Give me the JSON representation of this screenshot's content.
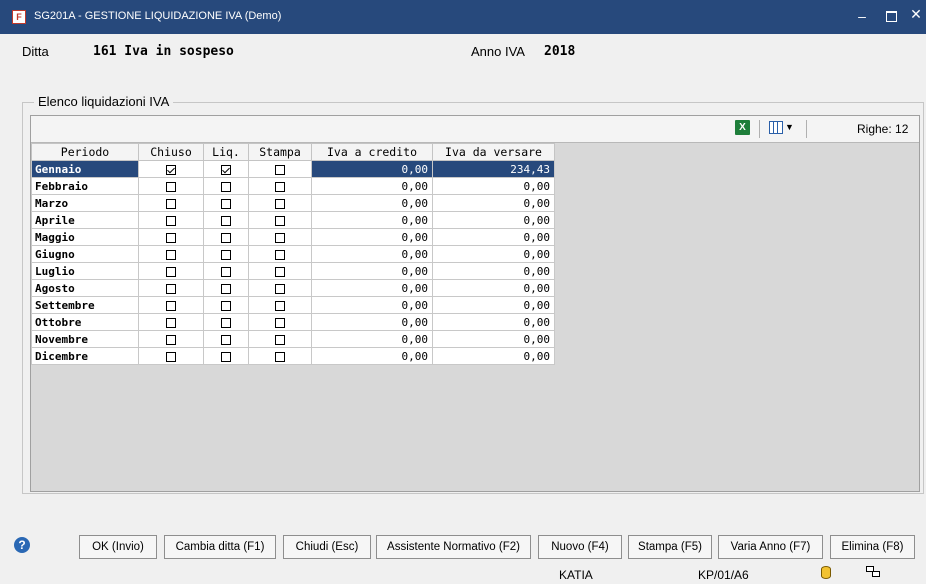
{
  "window": {
    "title": "SG201A - GESTIONE LIQUIDAZIONE IVA  (Demo)",
    "app_icon_letter": "F",
    "minimize_glyph": "–",
    "close_glyph": "✕"
  },
  "header": {
    "ditta_label": "Ditta",
    "ditta_value": "161 Iva in sospeso",
    "anno_label": "Anno IVA",
    "anno_value": "2018"
  },
  "group": {
    "title": "Elenco liquidazioni IVA"
  },
  "toolbar": {
    "excel_icon": "excel-icon",
    "excel_letter": "X",
    "columns_icon": "columns-chooser-icon",
    "dropdown_glyph": "▼",
    "rows_count": "Righe: 12"
  },
  "table": {
    "columns": [
      "Periodo",
      "Chiuso",
      "Liq.",
      "Stampa",
      "Iva a credito",
      "Iva da versare"
    ],
    "rows": [
      {
        "periodo": "Gennaio",
        "chiuso": true,
        "liq": true,
        "stampa": false,
        "credito": "0,00",
        "versare": "234,43",
        "selected": true
      },
      {
        "periodo": "Febbraio",
        "chiuso": false,
        "liq": false,
        "stampa": false,
        "credito": "0,00",
        "versare": "0,00"
      },
      {
        "periodo": "Marzo",
        "chiuso": false,
        "liq": false,
        "stampa": false,
        "credito": "0,00",
        "versare": "0,00"
      },
      {
        "periodo": "Aprile",
        "chiuso": false,
        "liq": false,
        "stampa": false,
        "credito": "0,00",
        "versare": "0,00"
      },
      {
        "periodo": "Maggio",
        "chiuso": false,
        "liq": false,
        "stampa": false,
        "credito": "0,00",
        "versare": "0,00"
      },
      {
        "periodo": "Giugno",
        "chiuso": false,
        "liq": false,
        "stampa": false,
        "credito": "0,00",
        "versare": "0,00"
      },
      {
        "periodo": "Luglio",
        "chiuso": false,
        "liq": false,
        "stampa": false,
        "credito": "0,00",
        "versare": "0,00"
      },
      {
        "periodo": "Agosto",
        "chiuso": false,
        "liq": false,
        "stampa": false,
        "credito": "0,00",
        "versare": "0,00"
      },
      {
        "periodo": "Settembre",
        "chiuso": false,
        "liq": false,
        "stampa": false,
        "credito": "0,00",
        "versare": "0,00"
      },
      {
        "periodo": "Ottobre",
        "chiuso": false,
        "liq": false,
        "stampa": false,
        "credito": "0,00",
        "versare": "0,00"
      },
      {
        "periodo": "Novembre",
        "chiuso": false,
        "liq": false,
        "stampa": false,
        "credito": "0,00",
        "versare": "0,00"
      },
      {
        "periodo": "Dicembre",
        "chiuso": false,
        "liq": false,
        "stampa": false,
        "credito": "0,00",
        "versare": "0,00"
      }
    ]
  },
  "buttons": {
    "ok": "OK (Invio)",
    "cambia_ditta": "Cambia ditta (F1)",
    "chiudi": "Chiudi (Esc)",
    "assistente": "Assistente Normativo (F2)",
    "nuovo": "Nuovo (F4)",
    "stampa": "Stampa (F5)",
    "varia_anno": "Varia Anno (F7)",
    "elimina": "Elimina (F8)"
  },
  "help_glyph": "?",
  "status": {
    "user": "KATIA",
    "station": "KP/01/A6"
  },
  "colors": {
    "titlebar": "#27497c",
    "selection": "#27497c",
    "grid_bg": "#d8d8d8"
  }
}
